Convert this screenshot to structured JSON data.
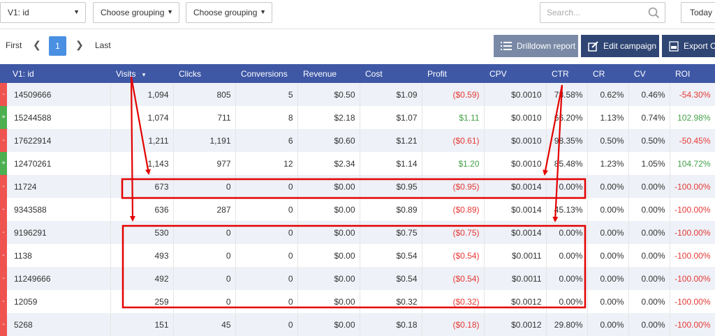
{
  "filters": {
    "group1": "V1: id",
    "group2": "Choose grouping",
    "group3": "Choose grouping",
    "search_placeholder": "Search...",
    "date_range": "Today"
  },
  "pagination": {
    "first": "First",
    "current": "1",
    "last": "Last"
  },
  "actions": {
    "drilldown": "Drilldown report",
    "edit": "Edit campaign",
    "export": "Export C"
  },
  "table": {
    "columns": [
      "V1: id",
      "Visits",
      "Clicks",
      "Conversions",
      "Revenue",
      "Cost",
      "Profit",
      "CPV",
      "CTR",
      "CR",
      "CV",
      "ROI"
    ],
    "sort_indicator": "▾",
    "rows": [
      {
        "mark": "-",
        "id": "14509666",
        "visits": "1,094",
        "clicks": "805",
        "conversions": "5",
        "revenue": "$0.50",
        "cost": "$1.09",
        "profit": "($0.59)",
        "cpv": "$0.0010",
        "ctr": "73.58%",
        "cr": "0.62%",
        "cv": "0.46%",
        "roi": "-54.30%"
      },
      {
        "mark": "+",
        "id": "15244588",
        "visits": "1,074",
        "clicks": "711",
        "conversions": "8",
        "revenue": "$2.18",
        "cost": "$1.07",
        "profit": "$1.11",
        "cpv": "$0.0010",
        "ctr": "66.20%",
        "cr": "1.13%",
        "cv": "0.74%",
        "roi": "102.98%"
      },
      {
        "mark": "-",
        "id": "17622914",
        "visits": "1,211",
        "clicks": "1,191",
        "conversions": "6",
        "revenue": "$0.60",
        "cost": "$1.21",
        "profit": "($0.61)",
        "cpv": "$0.0010",
        "ctr": "98.35%",
        "cr": "0.50%",
        "cv": "0.50%",
        "roi": "-50.45%"
      },
      {
        "mark": "+",
        "id": "12470261",
        "visits": "1,143",
        "clicks": "977",
        "conversions": "12",
        "revenue": "$2.34",
        "cost": "$1.14",
        "profit": "$1.20",
        "cpv": "$0.0010",
        "ctr": "85.48%",
        "cr": "1.23%",
        "cv": "1.05%",
        "roi": "104.72%"
      },
      {
        "mark": "-",
        "id": "11724",
        "visits": "673",
        "clicks": "0",
        "conversions": "0",
        "revenue": "$0.00",
        "cost": "$0.95",
        "profit": "($0.95)",
        "cpv": "$0.0014",
        "ctr": "0.00%",
        "cr": "0.00%",
        "cv": "0.00%",
        "roi": "-100.00%"
      },
      {
        "mark": "-",
        "id": "9343588",
        "visits": "636",
        "clicks": "287",
        "conversions": "0",
        "revenue": "$0.00",
        "cost": "$0.89",
        "profit": "($0.89)",
        "cpv": "$0.0014",
        "ctr": "45.13%",
        "cr": "0.00%",
        "cv": "0.00%",
        "roi": "-100.00%"
      },
      {
        "mark": "-",
        "id": "9196291",
        "visits": "530",
        "clicks": "0",
        "conversions": "0",
        "revenue": "$0.00",
        "cost": "$0.75",
        "profit": "($0.75)",
        "cpv": "$0.0014",
        "ctr": "0.00%",
        "cr": "0.00%",
        "cv": "0.00%",
        "roi": "-100.00%"
      },
      {
        "mark": "-",
        "id": "1138",
        "visits": "493",
        "clicks": "0",
        "conversions": "0",
        "revenue": "$0.00",
        "cost": "$0.54",
        "profit": "($0.54)",
        "cpv": "$0.0011",
        "ctr": "0.00%",
        "cr": "0.00%",
        "cv": "0.00%",
        "roi": "-100.00%"
      },
      {
        "mark": "-",
        "id": "11249666",
        "visits": "492",
        "clicks": "0",
        "conversions": "0",
        "revenue": "$0.00",
        "cost": "$0.54",
        "profit": "($0.54)",
        "cpv": "$0.0011",
        "ctr": "0.00%",
        "cr": "0.00%",
        "cv": "0.00%",
        "roi": "-100.00%"
      },
      {
        "mark": "-",
        "id": "12059",
        "visits": "259",
        "clicks": "0",
        "conversions": "0",
        "revenue": "$0.00",
        "cost": "$0.32",
        "profit": "($0.32)",
        "cpv": "$0.0012",
        "ctr": "0.00%",
        "cr": "0.00%",
        "cv": "0.00%",
        "roi": "-100.00%"
      },
      {
        "mark": "-",
        "id": "5268",
        "visits": "151",
        "clicks": "45",
        "conversions": "0",
        "revenue": "$0.00",
        "cost": "$0.18",
        "profit": "($0.18)",
        "cpv": "$0.0012",
        "ctr": "29.80%",
        "cr": "0.00%",
        "cv": "0.00%",
        "roi": "-100.00%"
      }
    ]
  },
  "colors": {
    "header": "#3e58a6",
    "negative": "#e53935",
    "positive": "#43a047",
    "annotation": "#e30000",
    "primary_button": "#2f4573"
  }
}
